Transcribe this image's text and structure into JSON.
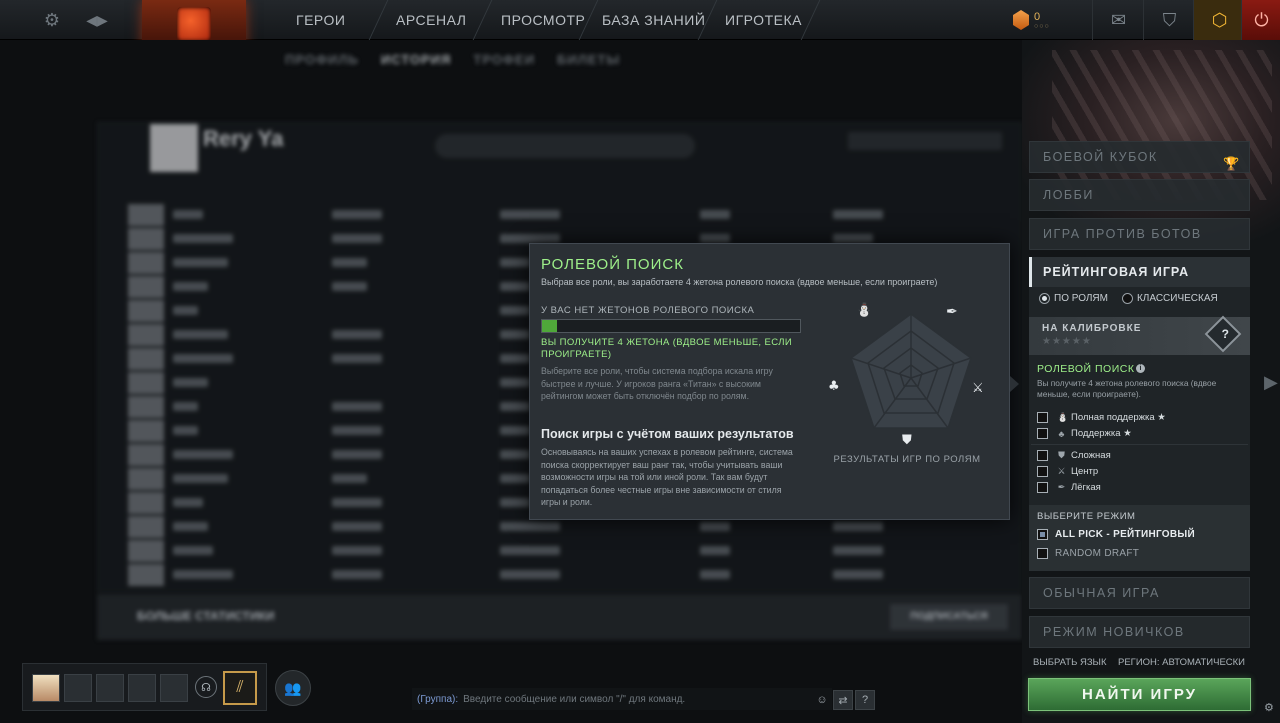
{
  "nav": {
    "items": [
      "ГЕРОИ",
      "АРСЕНАЛ",
      "ПРОСМОТР",
      "БАЗА ЗНАНИЙ",
      "ИГРОТЕКА"
    ],
    "currency_value": "0",
    "currency_dots": "○○○"
  },
  "profile": {
    "tabs": [
      "ПРОФИЛЬ",
      "ИСТОРИЯ",
      "ТРОФЕИ",
      "БИЛЕТЫ"
    ],
    "name": "Rery Ya",
    "more_stats": "БОЛЬШЕ СТАТИСТИКИ",
    "subscribe": "ПОДПИСАТЬСЯ"
  },
  "chat": {
    "channel": "(Группа):",
    "placeholder": "Введите сообщение или символ \"/\" для команд."
  },
  "popup": {
    "title": "РОЛЕВОЙ ПОИСК",
    "subtitle": "Выбрав все роли, вы заработаете 4 жетона ролевого поиска (вдвое меньше, если проиграете)",
    "no_tokens": "У ВАС НЕТ ЖЕТОНОВ РОЛЕВОГО ПОИСКА",
    "bar_fraction": 0.06,
    "will_get": "ВЫ ПОЛУЧИТЕ 4 ЖЕТОНА (ВДВОЕ МЕНЬШЕ, ЕСЛИ ПРОИГРАЕТЕ)",
    "desc": "Выберите все роли, чтобы система подбора искала игру быстрее и лучше. У игроков ранга «Титан» с высоким рейтингом может быть отключён подбор по ролям.",
    "heading2": "Поиск игры с учётом ваших результатов",
    "desc2": "Основываясь на ваших успехах в ролевом рейтинге, система поиска скорректирует ваш ранг так, чтобы учитывать ваши возможности игры на той или иной роли. Так вам будут попадаться более честные игры вне зависимости от стиля игры и роли.",
    "radar_label": "РЕЗУЛЬТАТЫ ИГР ПО РОЛЯМ"
  },
  "modes": {
    "battle_cup": "БОЕВОЙ КУБОК",
    "lobby": "ЛОББИ",
    "bots": "ИГРА ПРОТИВ БОТОВ",
    "ranked": "РЕЙТИНГОВАЯ ИГРА",
    "by_roles": "ПО РОЛЯМ",
    "classic": "КЛАССИЧЕСКАЯ",
    "calibration": "НА КАЛИБРОВКЕ",
    "calibration_stars": "★★★★★",
    "calibration_mark": "?",
    "normal": "ОБЫЧНАЯ ИГРА",
    "newbie": "РЕЖИМ НОВИЧКОВ"
  },
  "role_search": {
    "title": "РОЛЕВОЙ ПОИСК",
    "info": "i",
    "desc": "Вы получите 4 жетона ролевого поиска (вдвое меньше, если проиграете).",
    "roles": [
      {
        "label": "Полная поддержка ★",
        "icon": "hard-support-icon",
        "glyph": "⛄"
      },
      {
        "label": "Поддержка ★",
        "icon": "support-icon",
        "glyph": "♣"
      },
      {
        "label": "Сложная",
        "icon": "offlane-icon",
        "glyph": "⛊"
      },
      {
        "label": "Центр",
        "icon": "mid-icon",
        "glyph": "⚔"
      },
      {
        "label": "Лёгкая",
        "icon": "safelane-icon",
        "glyph": "✒"
      }
    ]
  },
  "game_mode": {
    "title": "ВЫБЕРИТЕ РЕЖИМ",
    "all_pick": "ALL PICK - РЕЙТИНГОВЫЙ",
    "random_draft": "RANDOM DRAFT"
  },
  "footer": {
    "language": "ВЫБРАТЬ ЯЗЫК",
    "region": "РЕГИОН: АВТОМАТИЧЕСКИ",
    "find": "НАЙТИ ИГРУ"
  },
  "colors": {
    "accent_green": "#9ef08a",
    "find_button": "#4a9a4e",
    "brand_red": "#c8331a"
  }
}
